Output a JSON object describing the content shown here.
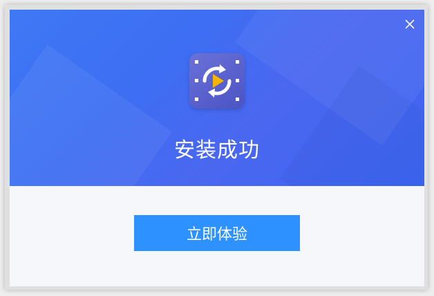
{
  "dialog": {
    "title": "安装成功",
    "primary_button_label": "立即体验",
    "close_icon": "close-icon",
    "app_icon": "video-converter-icon"
  },
  "colors": {
    "header_blue": "#3f6ef4",
    "button_blue": "#2d92ff",
    "footer_bg": "#f5f7fa",
    "icon_bg": "#5a60cf",
    "play_yellow": "#f7b500"
  }
}
